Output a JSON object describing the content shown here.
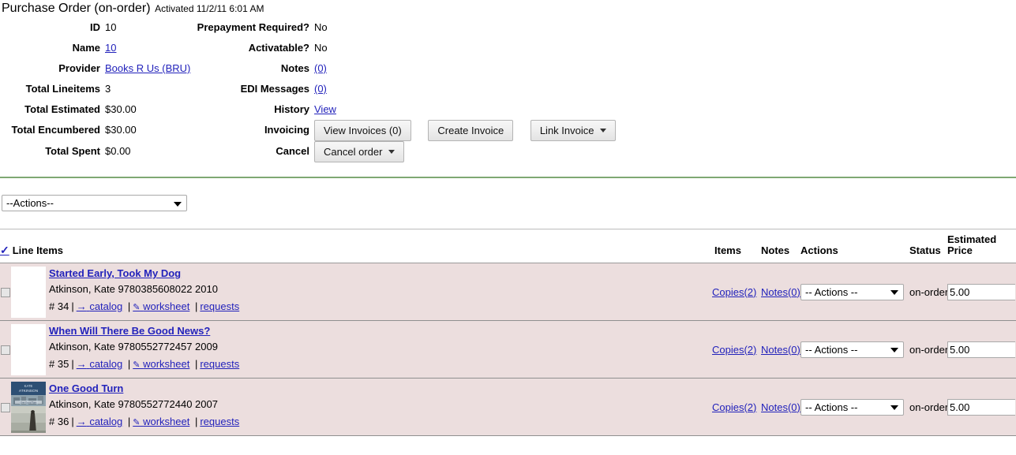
{
  "header": {
    "title": "Purchase Order (on-order)",
    "activated_label": "Activated 11/2/11 6:01 AM"
  },
  "summary": {
    "left": [
      {
        "label": "ID",
        "value": "10",
        "link": false
      },
      {
        "label": "Name",
        "value": "10",
        "link": true
      },
      {
        "label": "Provider",
        "value": "Books R Us (BRU)",
        "link": true
      },
      {
        "label": "Total Lineitems",
        "value": "3",
        "link": false
      },
      {
        "label": "Total Estimated",
        "value": "$30.00",
        "link": false
      },
      {
        "label": "Total Encumbered",
        "value": "$30.00",
        "link": false
      },
      {
        "label": "Total Spent",
        "value": "$0.00",
        "link": false
      }
    ],
    "right": [
      {
        "label": "Prepayment Required?",
        "value": "No",
        "link": false
      },
      {
        "label": "Activatable?",
        "value": "No",
        "link": false
      },
      {
        "label": "Notes",
        "value": "(0)",
        "link": true
      },
      {
        "label": "EDI Messages",
        "value": "(0)",
        "link": true
      },
      {
        "label": "History",
        "value": "View",
        "link": true
      },
      {
        "label": "Invoicing",
        "value": "",
        "link": false
      },
      {
        "label": "Cancel",
        "value": "",
        "link": false
      }
    ],
    "invoicing_label": "Invoicing",
    "cancel_label": "Cancel"
  },
  "buttons": {
    "view_invoices": "View Invoices (0)",
    "create_invoice": "Create Invoice",
    "link_invoice": "Link Invoice",
    "cancel_order": "Cancel order"
  },
  "actions_select": {
    "value": "--Actions--"
  },
  "line_items": {
    "select_all_icon": "check-icon",
    "heading": "Line Items",
    "columns": {
      "items": "Items",
      "notes": "Notes",
      "actions": "Actions",
      "status": "Status",
      "estimated_price": "Estimated Price"
    },
    "rows": [
      {
        "title": "Started Early, Took My Dog",
        "meta": "Atkinson, Kate 9780385608022 2010",
        "number": "# 34",
        "catalog_label": "catalog",
        "worksheet_label": "worksheet",
        "requests_label": "requests",
        "copies": "Copies(2)",
        "notes": "Notes(0)",
        "action_value": "-- Actions --",
        "status": "on-order",
        "price": "5.00",
        "has_cover": false
      },
      {
        "title": "When Will There Be Good News?",
        "meta": "Atkinson, Kate 9780552772457 2009",
        "number": "# 35",
        "catalog_label": "catalog",
        "worksheet_label": "worksheet",
        "requests_label": "requests",
        "copies": "Copies(2)",
        "notes": "Notes(0)",
        "action_value": "-- Actions --",
        "status": "on-order",
        "price": "5.00",
        "has_cover": false
      },
      {
        "title": "One Good Turn",
        "meta": "Atkinson, Kate 9780552772440 2007",
        "number": "# 36",
        "catalog_label": "catalog",
        "worksheet_label": "worksheet",
        "requests_label": "requests",
        "copies": "Copies(2)",
        "notes": "Notes(0)",
        "action_value": "-- Actions --",
        "status": "on-order",
        "price": "5.00",
        "has_cover": true
      }
    ]
  },
  "icons": {
    "arrow": "→",
    "pencil": "✎",
    "caret_down": "▼",
    "check": "✓"
  },
  "colors": {
    "link": "#2222bb",
    "row_background": "#ecdede",
    "divider_green": "#7fa873",
    "row_divider": "#8f8f8f"
  }
}
